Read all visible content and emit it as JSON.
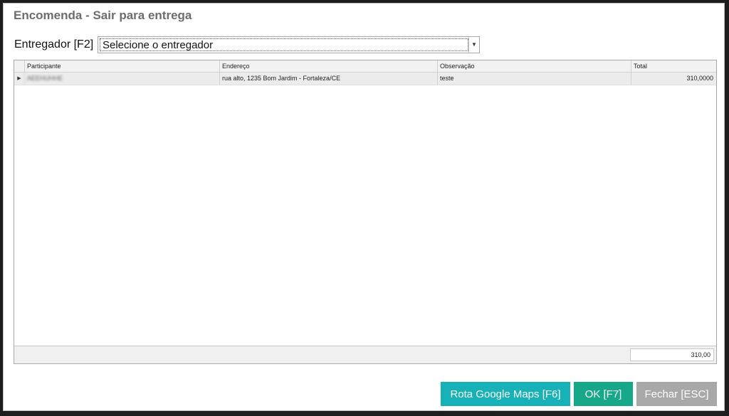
{
  "window": {
    "title": "Encomenda - Sair para entrega"
  },
  "courier": {
    "label": "Entregador [F2]",
    "selected": "Selecione o entregador"
  },
  "grid": {
    "columns": [
      "Participante",
      "Endereço",
      "Observação",
      "Total"
    ],
    "rows": [
      {
        "participante": "AEEHUHHE",
        "endereco": "rua alto, 1235  Bom Jardim - Fortaleza/CE",
        "observacao": "teste",
        "total": "310,0000"
      }
    ],
    "footer_total": "310,00"
  },
  "buttons": {
    "maps": "Rota Google Maps [F6]",
    "ok": "OK [F7]",
    "close": "Fechar [ESC]"
  },
  "colors": {
    "maps_button": "#17b1b8",
    "ok_button": "#17a889",
    "close_button": "#a8a8a8",
    "title_text": "#6d6d6d"
  }
}
